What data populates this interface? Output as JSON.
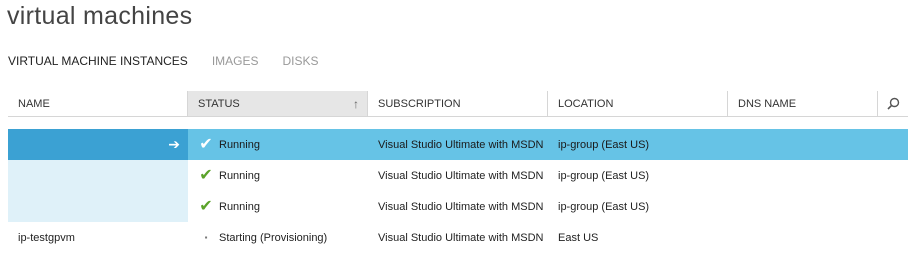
{
  "page": {
    "title": "virtual machines"
  },
  "tabs": [
    {
      "label": "VIRTUAL MACHINE INSTANCES",
      "active": true
    },
    {
      "label": "IMAGES",
      "active": false
    },
    {
      "label": "DISKS",
      "active": false
    }
  ],
  "columns": {
    "name": "NAME",
    "status": "STATUS",
    "subscription": "SUBSCRIPTION",
    "location": "LOCATION",
    "dns": "DNS NAME"
  },
  "rows": [
    {
      "name": "",
      "status": "Running",
      "subscription": "Visual Studio Ultimate with MSDN",
      "location": "ip-group (East US)",
      "dns": "",
      "selected": true,
      "icon": "check-icon"
    },
    {
      "name": "",
      "status": "Running",
      "subscription": "Visual Studio Ultimate with MSDN",
      "location": "ip-group (East US)",
      "dns": "",
      "selected": false,
      "icon": "check-icon"
    },
    {
      "name": "",
      "status": "Running",
      "subscription": "Visual Studio Ultimate with MSDN",
      "location": "ip-group (East US)",
      "dns": "",
      "selected": false,
      "icon": "check-icon"
    },
    {
      "name": "ip-testgpvm",
      "status": "Starting (Provisioning)",
      "subscription": "Visual Studio Ultimate with MSDN",
      "location": "East US",
      "dns": "",
      "selected": false,
      "icon": "dot-icon"
    }
  ],
  "colors": {
    "selected_row": "#66c3e6",
    "selected_name": "#3ba1d3",
    "light_name": "#dff1f9",
    "check": "#5ba32a"
  }
}
